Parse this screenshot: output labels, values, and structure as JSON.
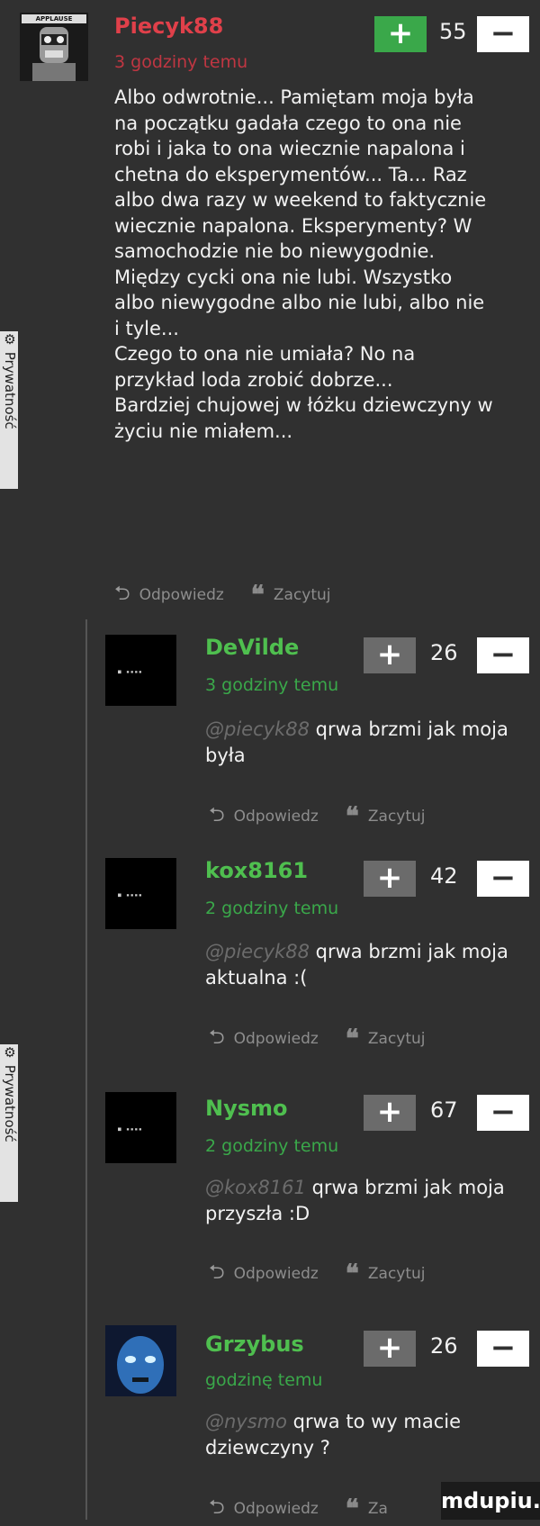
{
  "sidebar": {
    "label_1": "⚙ Prywatność",
    "label_2": "⚙ Prywatność"
  },
  "main_post": {
    "avatar_label": "APPLAUSE",
    "username": "Piecyk88",
    "time": "3 godziny temu",
    "score": "55",
    "lines": [
      "Albo odwrotnie... Pamiętam moja była",
      "na początku gadała czego to ona nie",
      "robi i jaka to ona wiecznie napalona i",
      "chetna do eksperymentów... Ta... Raz",
      "albo dwa razy w weekend to faktycznie",
      "wiecznie napalona. Eksperymenty? W",
      "samochodzie nie bo niewygodnie.",
      "Między cycki ona nie lubi. Wszystko",
      "albo niewygodne albo nie lubi, albo nie",
      "i tyle...",
      "Czego to ona nie umiała? No na",
      "przykład loda zrobić dobrze...",
      "Bardziej chujowej w łóżku dziewczyny w",
      "życiu nie miałem..."
    ],
    "reply_label": "Odpowiedz",
    "quote_label": "Zacytuj"
  },
  "replies": [
    {
      "username": "DeVilde",
      "time": "3 godziny temu",
      "score": "26",
      "mention": "@piecyk88",
      "line1": "qrwa brzmi jak moja",
      "line2": "była",
      "reply_label": "Odpowiedz",
      "quote_label": "Zacytuj"
    },
    {
      "username": "kox8161",
      "time": "2 godziny temu",
      "score": "42",
      "mention": "@piecyk88",
      "line1": "qrwa brzmi jak moja",
      "line2": "aktualna :(",
      "reply_label": "Odpowiedz",
      "quote_label": "Zacytuj"
    },
    {
      "username": "Nysmo",
      "time": "2 godziny temu",
      "score": "67",
      "mention": "@kox8161",
      "line1": "qrwa brzmi jak moja",
      "line2": "przyszła :D",
      "reply_label": "Odpowiedz",
      "quote_label": "Zacytuj"
    },
    {
      "username": "Grzybus",
      "time": "godzinę temu",
      "score": "26",
      "mention": "@nysmo",
      "line1": "qrwa to wy macie",
      "line2": "dziewczyny ?",
      "reply_label": "Odpowiedz",
      "quote_label": "Za"
    }
  ],
  "avatar_tag": "■ ▪▪▪▪",
  "plus_label": "+",
  "minus_label": "−",
  "watermark": "mdupiu.pl",
  "colors": {
    "background": "#303030",
    "username_main": "#e0404a",
    "username_reply": "#4fbf4f",
    "plus_active": "#3aa84a"
  }
}
